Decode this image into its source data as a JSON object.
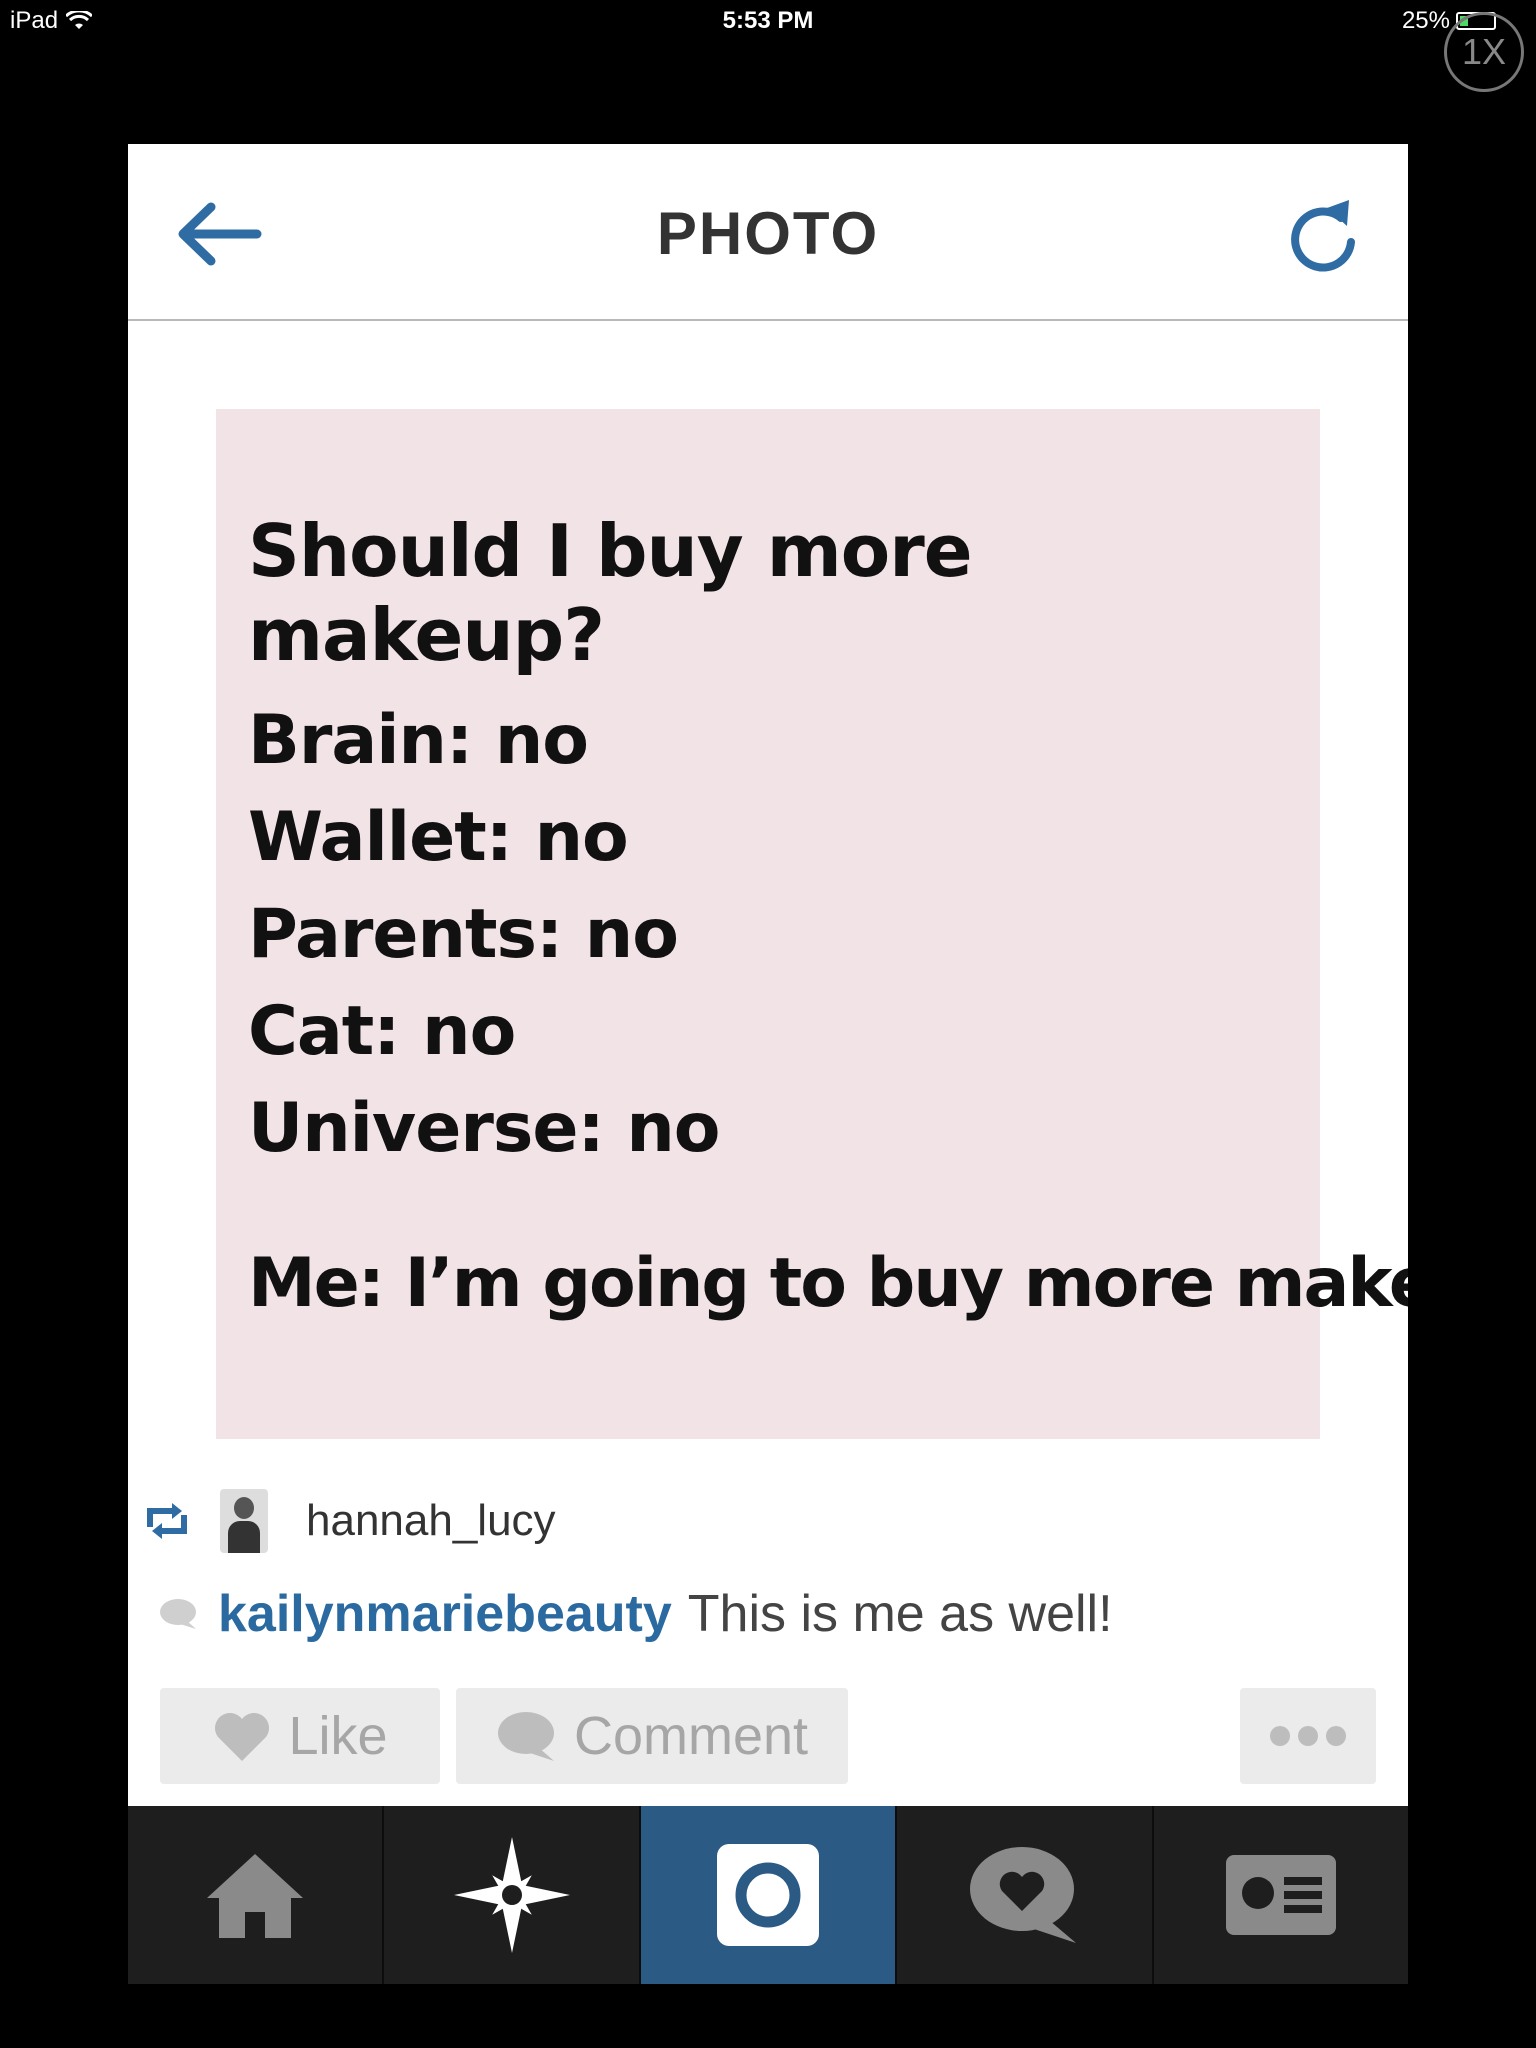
{
  "status_bar": {
    "device": "iPad",
    "time": "5:53 PM",
    "battery": "25%",
    "battery_level": 0.25,
    "zoom_badge": "1X"
  },
  "header": {
    "title": "PHOTO",
    "back_icon": "arrow-left-icon",
    "refresh_icon": "refresh-icon",
    "accent_color": "#2f6ca3"
  },
  "photo": {
    "background_color": "#f2e3e7",
    "question": "Should I buy more makeup?",
    "answers": [
      "Brain: no",
      "Wallet: no",
      "Parents: no",
      "Cat: no",
      "Universe: no"
    ],
    "conclusion": "Me: I’m going to buy more makeup"
  },
  "credit": {
    "repost_icon": "repost-icon",
    "username": "hannah_lucy"
  },
  "comment": {
    "user": "kailynmariebeauty",
    "text": "This is me as well!",
    "user_color": "#2a6aa0"
  },
  "actions": {
    "like_label": "Like",
    "comment_label": "Comment",
    "more_icon": "more-dots-icon"
  },
  "tabbar": {
    "tabs": [
      {
        "icon": "home-icon",
        "active": false
      },
      {
        "icon": "explore-star-icon",
        "active": false
      },
      {
        "icon": "camera-icon",
        "active": true
      },
      {
        "icon": "activity-heart-icon",
        "active": false
      },
      {
        "icon": "profile-card-icon",
        "active": false
      }
    ],
    "active_color": "#2b5b85"
  }
}
